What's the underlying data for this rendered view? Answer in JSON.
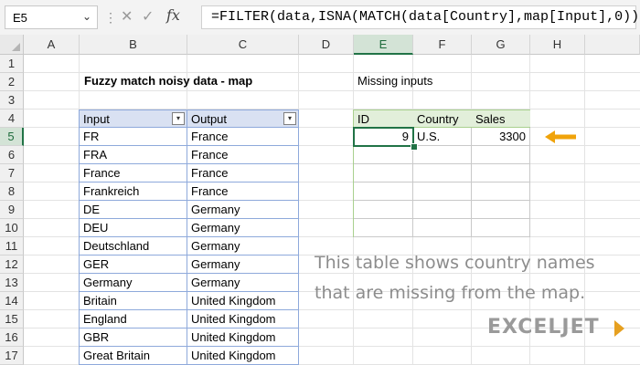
{
  "formula_bar": {
    "name_box": "E5",
    "name_box_arrow": "⌄",
    "dots": "⋮",
    "cancel_symbol": "✕",
    "enter_symbol": "✓",
    "fx_label": "fx",
    "formula": "=FILTER(data,ISNA(MATCH(data[Country],map[Input],0)),\"\")"
  },
  "columns": [
    "A",
    "B",
    "C",
    "D",
    "E",
    "F",
    "G",
    "H"
  ],
  "active_column": "E",
  "rows": [
    "1",
    "2",
    "3",
    "4",
    "5",
    "6",
    "7",
    "8",
    "9",
    "10",
    "11",
    "12",
    "13",
    "14",
    "15",
    "16",
    "17"
  ],
  "active_row": "5",
  "map_section": {
    "title": "Fuzzy match noisy data - map",
    "headers": [
      "Input",
      "Output"
    ],
    "rows": [
      [
        "FR",
        "France"
      ],
      [
        "FRA",
        "France"
      ],
      [
        "France",
        "France"
      ],
      [
        "Frankreich",
        "France"
      ],
      [
        "DE",
        "Germany"
      ],
      [
        "DEU",
        "Germany"
      ],
      [
        "Deutschland",
        "Germany"
      ],
      [
        "GER",
        "Germany"
      ],
      [
        "Germany",
        "Germany"
      ],
      [
        "Britain",
        "United Kingdom"
      ],
      [
        "England",
        "United Kingdom"
      ],
      [
        "GBR",
        "United Kingdom"
      ],
      [
        "Great Britain",
        "United Kingdom"
      ]
    ]
  },
  "missing_section": {
    "title": "Missing inputs",
    "headers": [
      "ID",
      "Country",
      "Sales"
    ],
    "result": [
      "9",
      "U.S.",
      "3300"
    ]
  },
  "annotation": {
    "line1": "This table shows country names",
    "line2": "that are missing from the map."
  },
  "logo": {
    "text": "EXCELJET"
  },
  "colors": {
    "arrow": "#f0a30a",
    "selection": "#217346",
    "map_header": "#d9e1f2",
    "result_header": "#e2efda"
  }
}
